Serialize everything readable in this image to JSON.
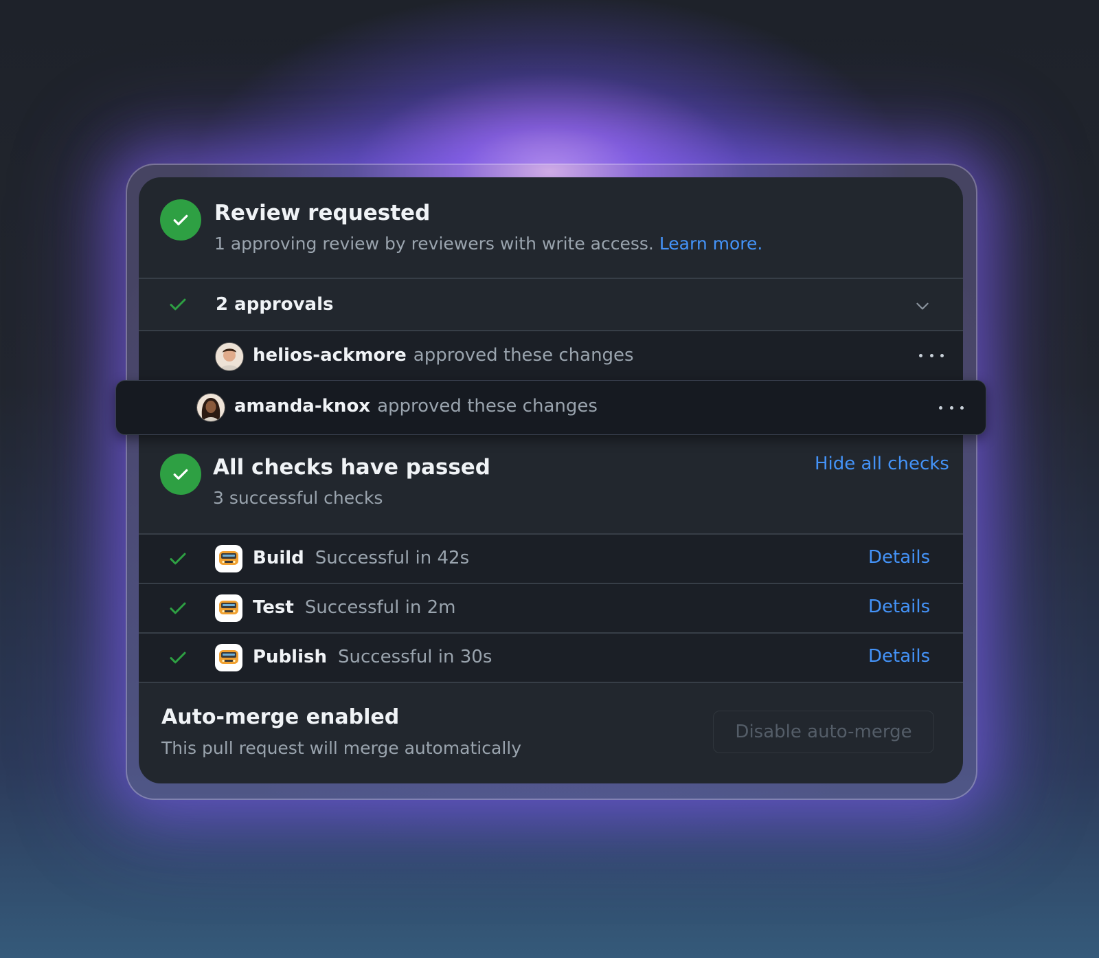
{
  "review": {
    "title": "Review requested",
    "subtitle": "1 approving review by reviewers with write access.",
    "learn_more": "Learn more."
  },
  "approvals": {
    "label": "2 approvals",
    "items": [
      {
        "user": "helios-ackmore",
        "action": "approved these changes"
      },
      {
        "user": "amanda-knox",
        "action": "approved these changes"
      }
    ]
  },
  "checks": {
    "title": "All checks have passed",
    "subtitle": "3 successful checks",
    "hide_label": "Hide all checks",
    "items": [
      {
        "name": "Build",
        "status": "Successful in 42s",
        "details": "Details"
      },
      {
        "name": "Test",
        "status": "Successful in 2m",
        "details": "Details"
      },
      {
        "name": "Publish",
        "status": "Successful in 30s",
        "details": "Details"
      }
    ]
  },
  "automerge": {
    "title": "Auto-merge enabled",
    "subtitle": "This pull request will merge automatically",
    "button": "Disable auto-merge"
  },
  "colors": {
    "success": "#2ea043",
    "link": "#4493f8",
    "glow": "#a26eff"
  },
  "icons": {
    "status": "check-circle-icon",
    "row_check": "check-icon",
    "expand": "chevron-down-icon",
    "more": "kebab-horizontal-icon",
    "app": "bus-icon"
  }
}
